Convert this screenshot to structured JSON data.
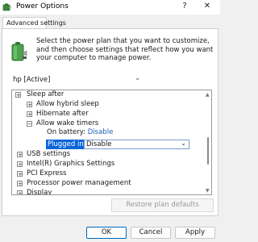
{
  "window": {
    "title": "Power Options",
    "help_glyph": "?",
    "close_glyph": "✕",
    "app_icon": "power-options-icon"
  },
  "tabs": [
    {
      "label": "Advanced settings"
    }
  ],
  "intro": {
    "text": "Select the power plan that you want to customize, and then choose settings that reflect how you want your computer to manage power.",
    "icon": "battery-plug-icon"
  },
  "plan_select": {
    "value": "hp [Active]"
  },
  "tree": {
    "items": [
      {
        "label": "Sleep after",
        "expander": "+"
      },
      {
        "label": "Allow hybrid sleep",
        "expander": "+"
      },
      {
        "label": "Hibernate after",
        "expander": "+"
      },
      {
        "label": "Allow wake timers",
        "expander": "−"
      },
      {
        "label": "USB settings",
        "expander": "+"
      },
      {
        "label": "Intel(R) Graphics Settings",
        "expander": "+"
      },
      {
        "label": "PCI Express",
        "expander": "+"
      },
      {
        "label": "Processor power management",
        "expander": "+"
      },
      {
        "label": "Display",
        "expander": "+"
      }
    ],
    "on_battery": {
      "label": "On battery:",
      "value": "Disable"
    },
    "plugged_in": {
      "label": "Plugged in:",
      "value": "Disable"
    }
  },
  "buttons": {
    "restore": "Restore plan defaults",
    "ok": "OK",
    "cancel": "Cancel",
    "apply": "Apply"
  },
  "colors": {
    "accent": "#0a66d8",
    "link": "#1a5fb4"
  }
}
